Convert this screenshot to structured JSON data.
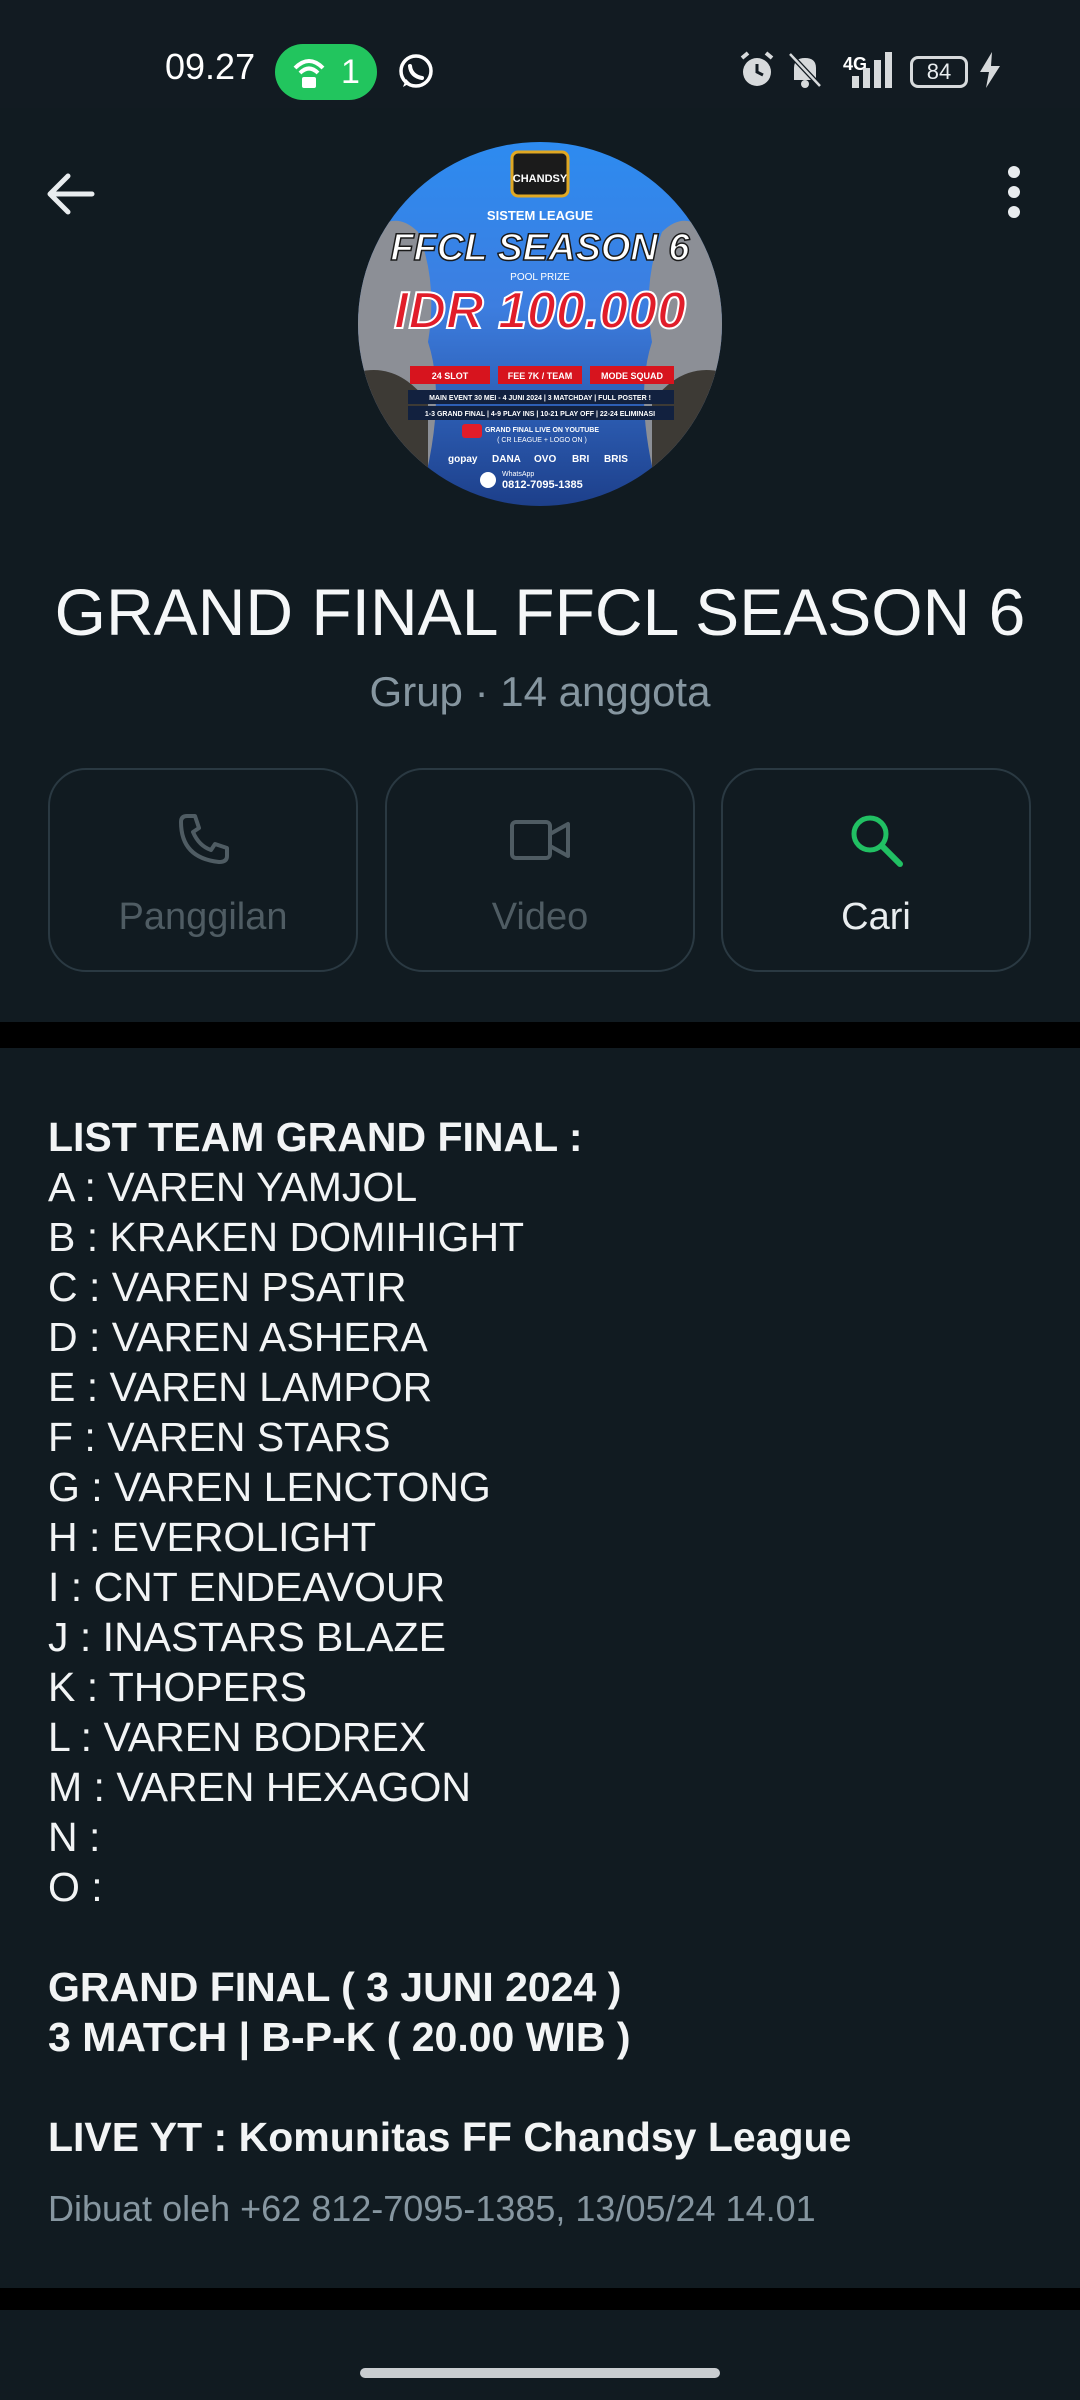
{
  "status_bar": {
    "time": "09.27",
    "hotspot_count": "1",
    "network": "4G",
    "battery": "84"
  },
  "header": {
    "title": "GRAND FINAL FFCL SEASON 6",
    "subtitle": "Grup · 14 anggota",
    "avatar": {
      "brand": "CHANDSY",
      "line1": "SISTEM LEAGUE",
      "line2": "FFCL SEASON 6",
      "line3": "POOL PRIZE",
      "prize": "IDR 100.000",
      "tags": [
        "24 SLOT",
        "FEE 7K / TEAM",
        "MODE SQUAD"
      ],
      "info1": "MAIN EVENT 30 MEI - 4 JUNI 2024 | 3 MATCHDAY | FULL POSTER !",
      "info2": "1-3 GRAND FINAL | 4-9 PLAY INS | 10-21 PLAY OFF | 22-24 ELIMINASI",
      "info3": "GRAND FINAL LIVE ON YOUTUBE",
      "info4": "( CR LEAGUE + LOGO ON )",
      "payments": [
        "gopay",
        "DANA",
        "OVO",
        "BRI",
        "BRIS"
      ],
      "whatsapp_label": "WhatsApp",
      "whatsapp": "0812-7095-1385"
    }
  },
  "actions": [
    {
      "label": "Panggilan",
      "icon": "phone-icon",
      "enabled": false
    },
    {
      "label": "Video",
      "icon": "video-icon",
      "enabled": false
    },
    {
      "label": "Cari",
      "icon": "search-icon",
      "enabled": true
    }
  ],
  "description": {
    "heading": "LIST TEAM GRAND FINAL :",
    "teams": [
      "A : VAREN YAMJOL",
      "B : KRAKEN DOMIHIGHT",
      "C : VAREN PSATIR",
      "D : VAREN ASHERA",
      "E : VAREN LAMPOR",
      "F : VAREN STARS",
      "G : VAREN LENCTONG",
      "H : EVEROLIGHT",
      "I : CNT ENDEAVOUR",
      "J : INASTARS BLAZE",
      "K : THOPERS",
      "L : VAREN BODREX",
      "M : VAREN HEXAGON",
      "N :",
      "O :"
    ],
    "final_line1": "GRAND FINAL ( 3 JUNI 2024 )",
    "final_line2": "3 MATCH | B-P-K ( 20.00 WIB )",
    "live": "LIVE YT : Komunitas FF Chandsy League",
    "created_by": "Dibuat oleh +62 812-7095-1385, 13/05/24 14.01"
  },
  "colors": {
    "background": "#0b141a",
    "panel": "#111b21",
    "accent_green": "#21c063",
    "muted": "#8696a0"
  }
}
